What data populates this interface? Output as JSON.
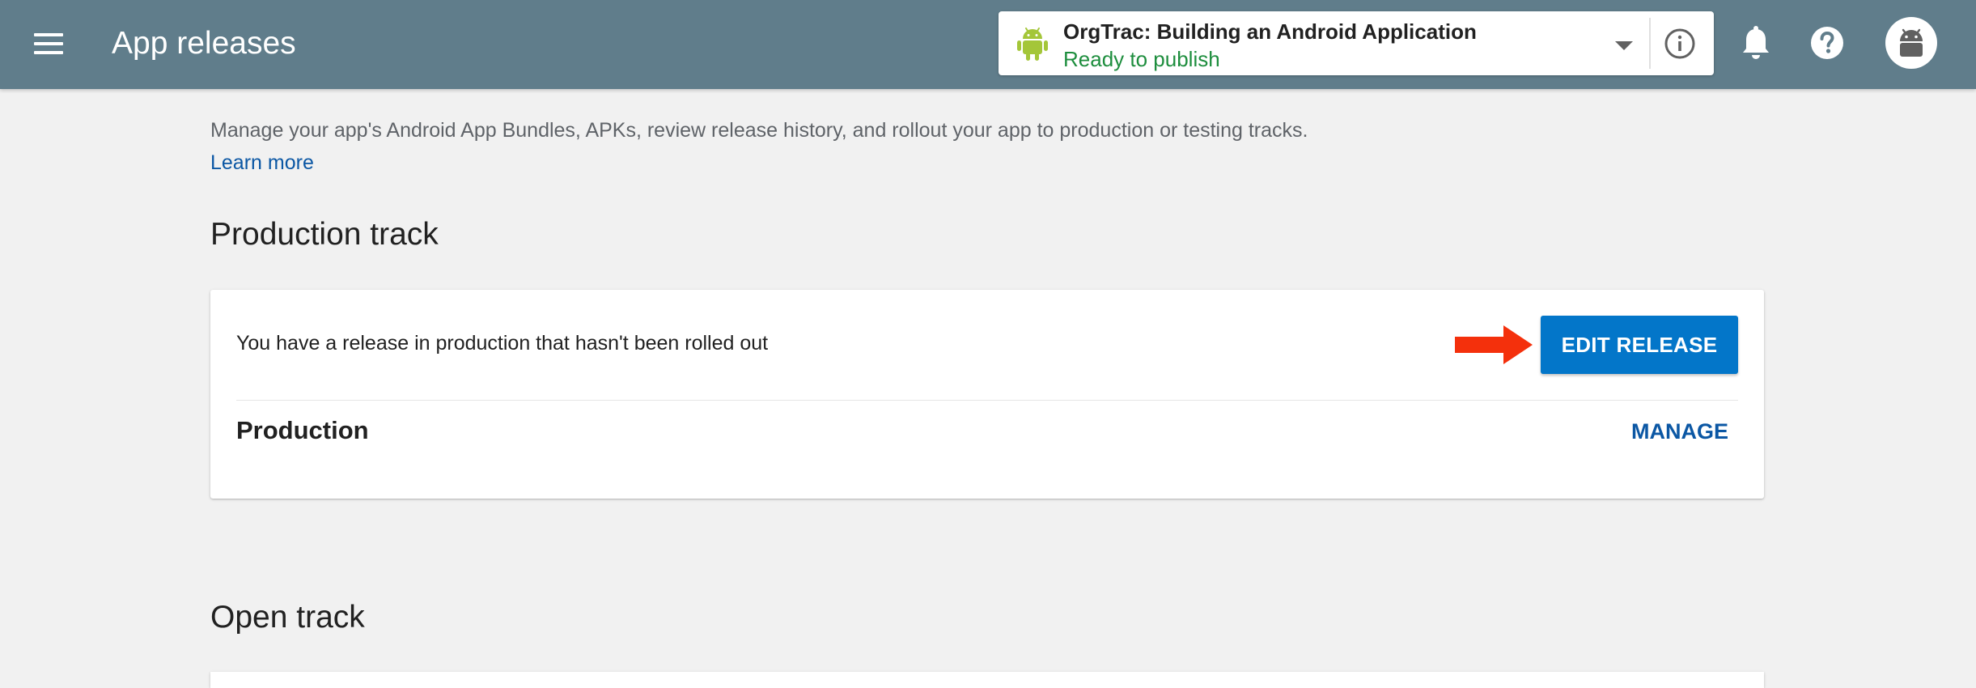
{
  "header": {
    "title": "App releases",
    "background_color": "#607d8b",
    "app_selector": {
      "app_name": "OrgTrac: Building an Android Application",
      "status": "Ready to publish",
      "status_color": "#1e8e3e",
      "app_icon": "android-icon"
    },
    "icons": [
      "menu-icon",
      "chevron-down-icon",
      "info-icon",
      "bell-icon",
      "help-icon",
      "avatar-android-icon"
    ]
  },
  "main": {
    "intro": "Manage your app's Android App Bundles, APKs, review release history, and rollout your app to production or testing tracks.",
    "learn_more": "Learn more",
    "production_section": {
      "heading": "Production track",
      "notice": "You have a release in production that hasn't been rolled out",
      "edit_button": "EDIT RELEASE",
      "track_name": "Production",
      "manage_link": "MANAGE",
      "accent_color": "#0376c9",
      "annotation_icon": "red-arrow-icon"
    },
    "open_section": {
      "heading": "Open track"
    }
  }
}
